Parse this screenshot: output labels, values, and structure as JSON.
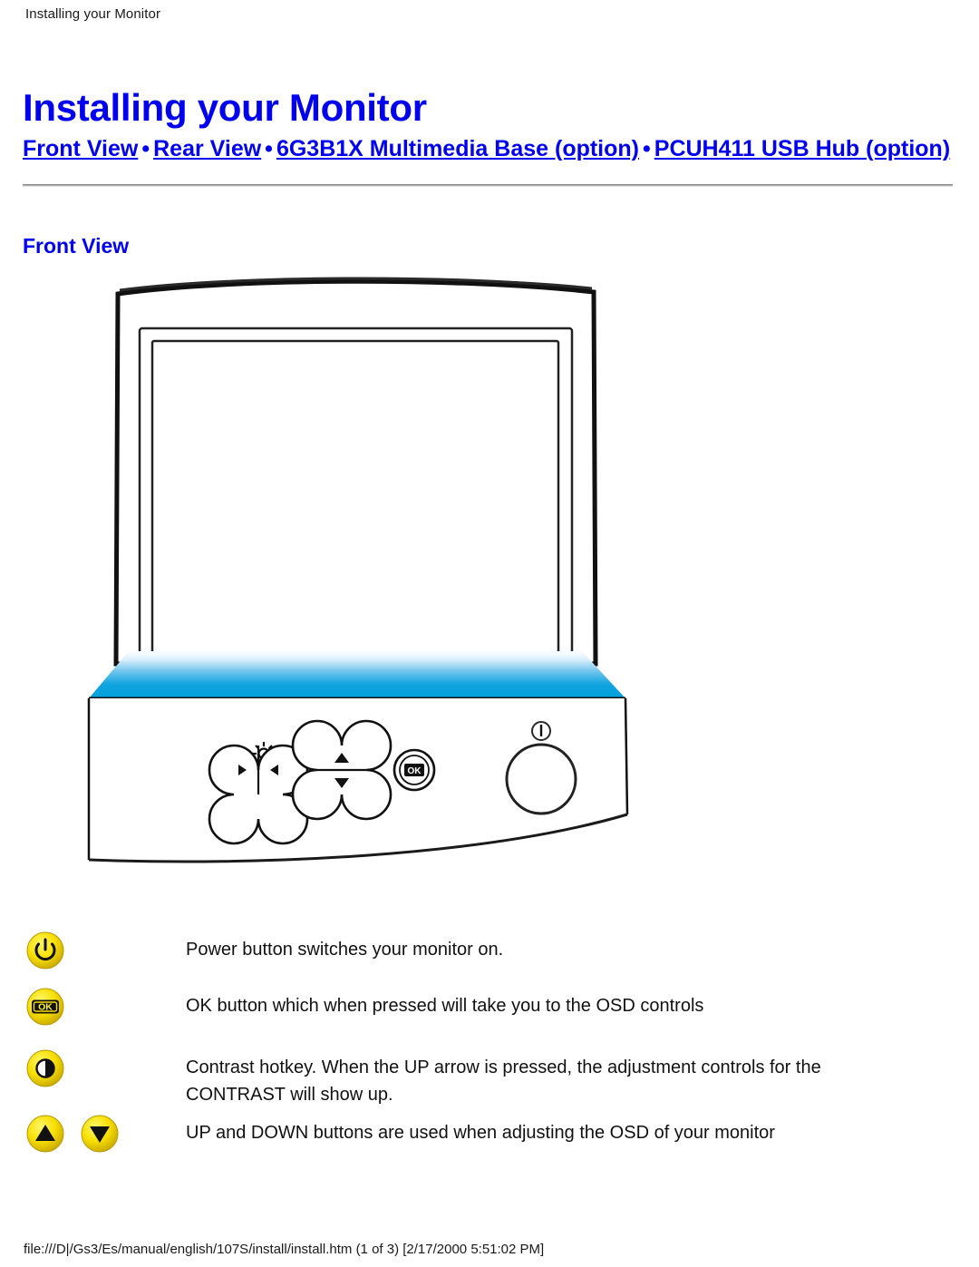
{
  "running_header": "Installing your Monitor",
  "title": "Installing your Monitor",
  "nav": {
    "separator": "•",
    "links": [
      {
        "label": "Front View"
      },
      {
        "label": "Rear View"
      },
      {
        "label": "6G3B1X Multimedia Base (option)"
      },
      {
        "label": "PCUH411 USB Hub (option)"
      }
    ]
  },
  "section": {
    "heading": "Front View"
  },
  "figure": {
    "name": "monitor-front-view-illustration",
    "alt": "Front view of the monitor showing the bezel controls",
    "controls": [
      {
        "name": "brightness-symbol",
        "label": "brightness"
      },
      {
        "name": "brightness-left-button",
        "label": "left"
      },
      {
        "name": "brightness-right-button",
        "label": "right"
      },
      {
        "name": "contrast-symbol",
        "label": "contrast"
      },
      {
        "name": "up-button",
        "label": "up"
      },
      {
        "name": "down-button",
        "label": "down"
      },
      {
        "name": "ok-button",
        "label": "OK"
      },
      {
        "name": "power-symbol",
        "label": "power"
      },
      {
        "name": "power-button",
        "label": "power"
      }
    ],
    "colors": {
      "bezel_gradient_top": "#ffffff",
      "bezel_gradient_bottom": "#00A0DC",
      "outline": "#000000"
    }
  },
  "legend": {
    "items": [
      {
        "icons": [
          "power-icon"
        ],
        "text": "Power button switches your monitor on."
      },
      {
        "icons": [
          "ok-icon"
        ],
        "text": "OK button which when pressed will take you to the OSD controls"
      },
      {
        "icons": [
          "contrast-icon"
        ],
        "text": "Contrast hotkey. When the UP arrow is pressed, the adjustment controls for the CONTRAST will show up."
      },
      {
        "icons": [
          "up-arrow-icon",
          "down-arrow-icon"
        ],
        "text": "UP and DOWN buttons are used when adjusting the OSD of your monitor"
      }
    ],
    "icon_colors": {
      "fill_light": "#FFF23A",
      "fill": "#F2D900",
      "fill_dark": "#C8AE00",
      "glyph": "#000000"
    }
  },
  "footer": {
    "path": "file:///D|/Gs3/Es/manual/english/107S/install/install.htm (1 of 3) [2/17/2000 5:51:02 PM]"
  },
  "theme": {
    "link_color": "#0000EE",
    "text_color": "#111111",
    "background": "#ffffff"
  }
}
